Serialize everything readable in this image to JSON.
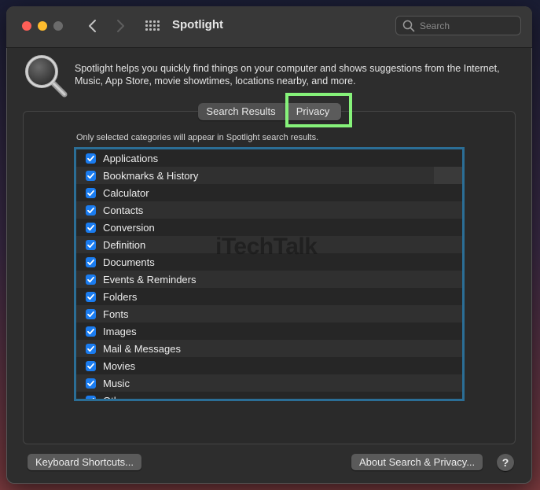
{
  "window": {
    "title": "Spotlight",
    "back_icon": "chevron-left-icon",
    "forward_icon": "chevron-right-icon",
    "grid_icon": "grid-icon"
  },
  "search": {
    "placeholder": "Search",
    "value": ""
  },
  "header": {
    "icon": "magnifying-glass-icon",
    "description": "Spotlight helps you quickly find things on your computer and shows suggestions from the Internet, Music, App Store, movie showtimes, locations nearby, and more."
  },
  "tabs": {
    "search_results": "Search Results",
    "privacy": "Privacy",
    "highlighted": "Privacy",
    "highlight_color": "#86f27a"
  },
  "categories": {
    "hint": "Only selected categories will appear in Spotlight search results.",
    "items": [
      {
        "label": "Applications",
        "checked": true
      },
      {
        "label": "Bookmarks & History",
        "checked": true
      },
      {
        "label": "Calculator",
        "checked": true
      },
      {
        "label": "Contacts",
        "checked": true
      },
      {
        "label": "Conversion",
        "checked": true
      },
      {
        "label": "Definition",
        "checked": true
      },
      {
        "label": "Documents",
        "checked": true
      },
      {
        "label": "Events & Reminders",
        "checked": true
      },
      {
        "label": "Folders",
        "checked": true
      },
      {
        "label": "Fonts",
        "checked": true
      },
      {
        "label": "Images",
        "checked": true
      },
      {
        "label": "Mail & Messages",
        "checked": true
      },
      {
        "label": "Movies",
        "checked": true
      },
      {
        "label": "Music",
        "checked": true
      },
      {
        "label": "Other",
        "checked": true
      }
    ],
    "frame_color": "#2b6e96"
  },
  "watermark": "iTechTalk",
  "footer": {
    "shortcuts_label": "Keyboard Shortcuts...",
    "about_label": "About Search & Privacy...",
    "help_label": "?"
  },
  "colors": {
    "checkbox": "#1a7cf0",
    "close": "#fe5f57",
    "minimize": "#febc2e"
  }
}
